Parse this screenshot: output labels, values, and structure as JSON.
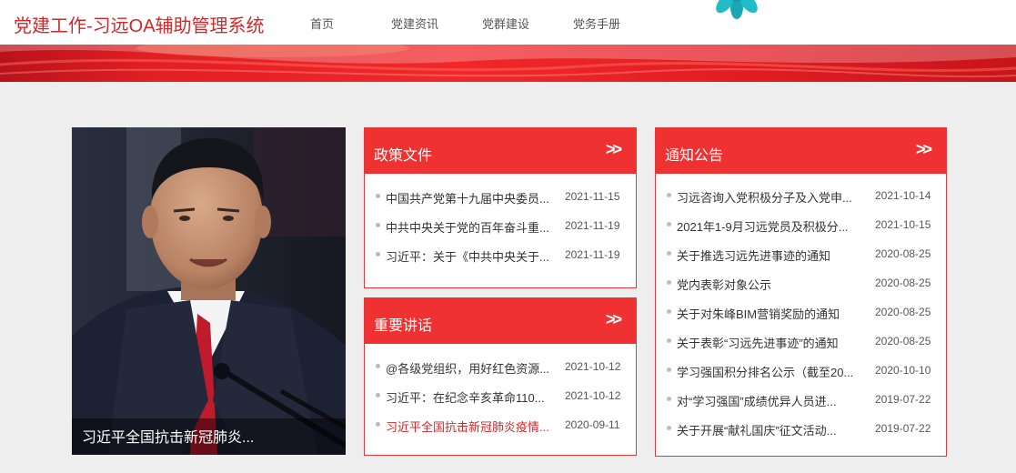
{
  "header": {
    "site_title": "党建工作-习远OA辅助管理系统",
    "nav": [
      {
        "label": "首页"
      },
      {
        "label": "党建资讯"
      },
      {
        "label": "党群建设"
      },
      {
        "label": "党务手册"
      }
    ]
  },
  "colors": {
    "brand_red": "#ef3132",
    "title_red": "#d4272a",
    "page_bg": "#eeeeef"
  },
  "featured": {
    "caption": "习近平全国抗击新冠肺炎..."
  },
  "policy_docs": {
    "title": "政策文件",
    "more_icon": "double-chevron-right-icon",
    "items": [
      {
        "title": "中国共产党第十九届中央委员...",
        "date": "2021-11-15"
      },
      {
        "title": "中共中央关于党的百年奋斗重...",
        "date": "2021-11-19"
      },
      {
        "title": "习近平：关于《中共中央关于...",
        "date": "2021-11-19"
      }
    ]
  },
  "speeches": {
    "title": "重要讲话",
    "more_icon": "double-chevron-right-icon",
    "items": [
      {
        "title": "@各级党组织，用好红色资源...",
        "date": "2021-10-12"
      },
      {
        "title": "习近平：在纪念辛亥革命110...",
        "date": "2021-10-12"
      },
      {
        "title": "习近平全国抗击新冠肺炎疫情...",
        "date": "2020-09-11"
      }
    ]
  },
  "notices": {
    "title": "通知公告",
    "more_icon": "double-chevron-right-icon",
    "items": [
      {
        "title": "习远咨询入党积极分子及入党申...",
        "date": "2021-10-14"
      },
      {
        "title": "2021年1-9月习远党员及积极分...",
        "date": "2021-10-15"
      },
      {
        "title": "关于推选习远先进事迹的通知",
        "date": "2020-08-25"
      },
      {
        "title": "党内表彰对象公示",
        "date": "2020-08-25"
      },
      {
        "title": "关于对朱峰BIM营销奖励的通知",
        "date": "2020-08-25"
      },
      {
        "title": "关于表彰“习远先进事迹”的通知",
        "date": "2020-08-25"
      },
      {
        "title": "学习强国积分排名公示（截至20...",
        "date": "2020-10-10"
      },
      {
        "title": "对“学习强国”成绩优异人员进...",
        "date": "2019-07-22"
      },
      {
        "title": "关于开展“献礼国庆”征文活动...",
        "date": "2019-07-22"
      }
    ]
  }
}
